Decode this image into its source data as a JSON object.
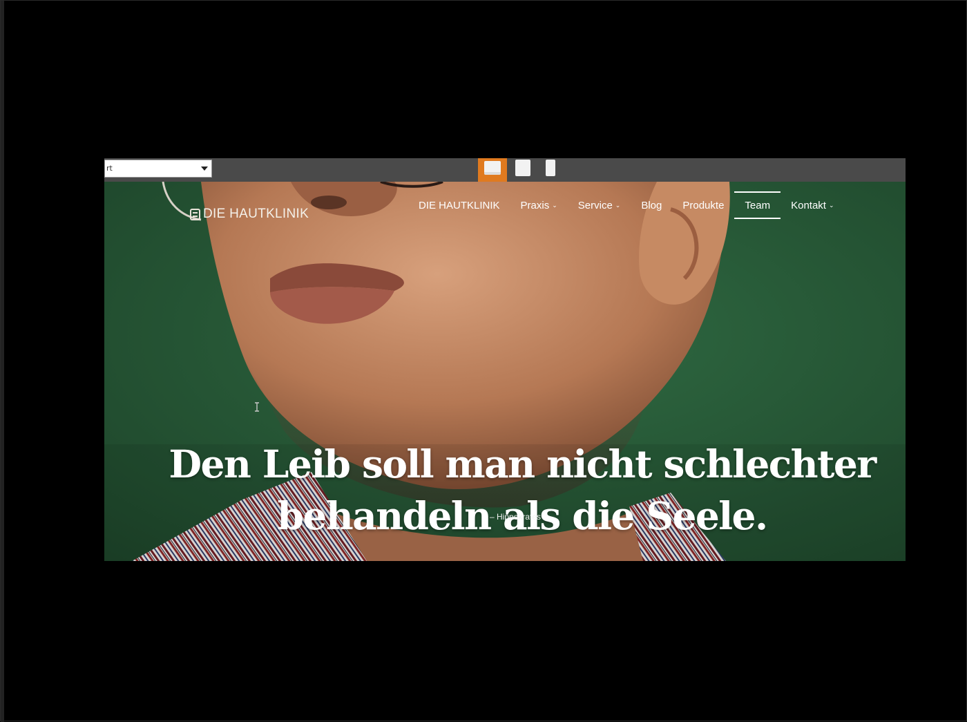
{
  "toolbar": {
    "page_select_value": "rt",
    "device_buttons": [
      "desktop-preview",
      "tablet-preview",
      "phone-preview"
    ],
    "active_device": "desktop",
    "accent_color": "#e07a1f"
  },
  "site": {
    "logo_text": "DIE HAUTKLINIK",
    "nav": [
      {
        "label": "DIE HAUTKLINIK",
        "dropdown": false
      },
      {
        "label": "Praxis",
        "dropdown": true
      },
      {
        "label": "Service",
        "dropdown": true
      },
      {
        "label": "Blog",
        "dropdown": false
      },
      {
        "label": "Produkte",
        "dropdown": false
      },
      {
        "label": "Team",
        "dropdown": false,
        "active": true
      },
      {
        "label": "Kontakt",
        "dropdown": true
      }
    ],
    "chevron": "⌄",
    "hero": {
      "quote_line_1": "Den Leib soll man nicht schlechter",
      "quote_line_2": "behandeln als die Seele.",
      "attribution": "– Hippokrates",
      "background_color": "#265234"
    }
  }
}
